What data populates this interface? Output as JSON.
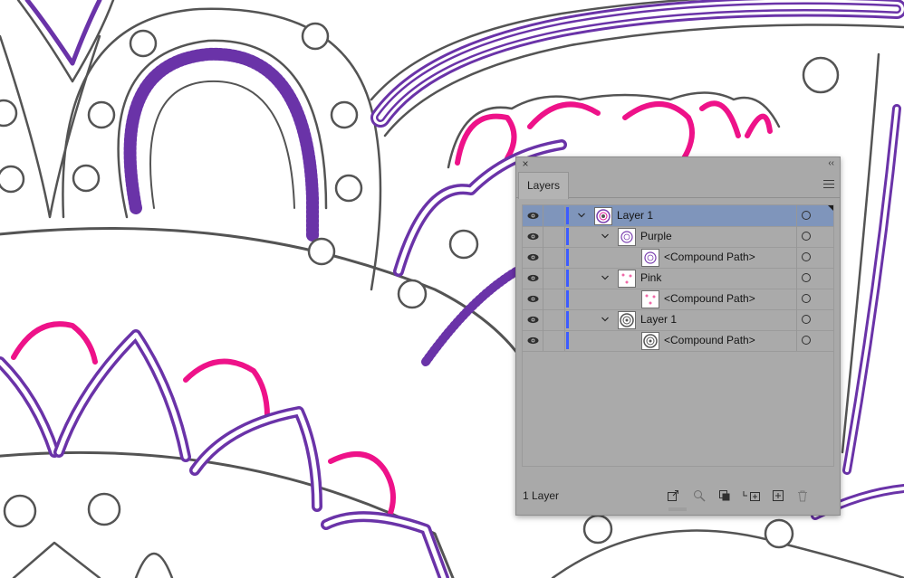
{
  "layers_panel": {
    "tab_label": "Layers",
    "footer_count": "1 Layer",
    "rows": [
      {
        "name": "Layer 1",
        "kind": "layer"
      },
      {
        "name": "Purple",
        "kind": "group"
      },
      {
        "name": "<Compound Path>",
        "kind": "path"
      },
      {
        "name": "Pink",
        "kind": "group"
      },
      {
        "name": "<Compound Path>",
        "kind": "path"
      },
      {
        "name": "Layer 1",
        "kind": "group"
      },
      {
        "name": "<Compound Path>",
        "kind": "path"
      }
    ],
    "selected_row_color": "#7f95bb",
    "layer_color": "#3d5cff"
  },
  "artwork": {
    "stroke_gray": "#545454",
    "purple": "#6a33a8",
    "pink": "#ee1289"
  }
}
